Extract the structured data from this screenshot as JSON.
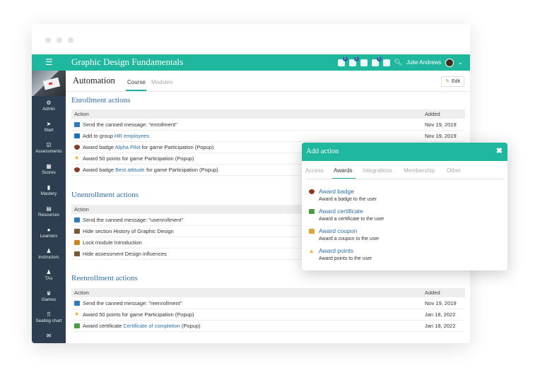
{
  "app": {
    "title": "Graphic Design Fundamentals",
    "menu_icon": "☰",
    "user_name": "Julie Andrews",
    "top_icons": [
      {
        "name": "notifications-icon",
        "badge": "1"
      },
      {
        "name": "flag-icon",
        "badge": "1"
      },
      {
        "name": "list-icon",
        "badge": ""
      },
      {
        "name": "cart-icon",
        "badge": "1"
      },
      {
        "name": "help-icon",
        "badge": ""
      }
    ]
  },
  "sidebar": {
    "items": [
      {
        "label": "Admin",
        "icon": "⚙"
      },
      {
        "label": "Start",
        "icon": "➤"
      },
      {
        "label": "Assessments",
        "icon": "☑"
      },
      {
        "label": "Scores",
        "icon": "▦"
      },
      {
        "label": "Mastery",
        "icon": "▮"
      },
      {
        "label": "Resources",
        "icon": "▤"
      },
      {
        "label": "Learners",
        "icon": "●"
      },
      {
        "label": "Instructors",
        "icon": "♟"
      },
      {
        "label": "TAs",
        "icon": "♟"
      },
      {
        "label": "Games",
        "icon": "♛"
      },
      {
        "label": "Seating chart",
        "icon": "⠿"
      },
      {
        "label": "",
        "icon": "✉"
      }
    ]
  },
  "page": {
    "title": "Automation",
    "tabs": [
      "Course",
      "Modules"
    ],
    "edit_label": "Edit"
  },
  "sections": {
    "enrollment": {
      "title": "Enrollment actions",
      "col_action": "Action",
      "col_added": "Added",
      "rows": [
        {
          "pre": "Send the canned message: \"enrollment\"",
          "link": "",
          "post": "",
          "date": "Nov 19, 2019",
          "icon": "message"
        },
        {
          "pre": "Add to group ",
          "link": "HR employees",
          "post": "",
          "date": "Nov 19, 2019",
          "icon": "group"
        },
        {
          "pre": "Award badge ",
          "link": "Alpha Pilot",
          "post": " for game Participation (Popup)",
          "date": "",
          "icon": "badge"
        },
        {
          "pre": "Award 50 points for game Participation (Popup)",
          "link": "",
          "post": "",
          "date": "",
          "icon": "star"
        },
        {
          "pre": "Award badge ",
          "link": "Best attitude",
          "post": " for game Participation (Popup)",
          "date": "",
          "icon": "badge"
        }
      ]
    },
    "unenrollment": {
      "title": "Unenrollment actions",
      "col_action": "Action",
      "rows": [
        {
          "pre": "Send the canned message: \"unenrollment\"",
          "link": "",
          "post": "",
          "icon": "message"
        },
        {
          "pre": "Hide section History of Graphic Design",
          "link": "",
          "post": "",
          "icon": "hide"
        },
        {
          "pre": "Lock module Introduction",
          "link": "",
          "post": "",
          "icon": "lock"
        },
        {
          "pre": "Hide assessment Design influences",
          "link": "",
          "post": "",
          "icon": "hide"
        }
      ]
    },
    "reenrollment": {
      "title": "Reenrollment actions",
      "col_action": "Action",
      "col_added": "Added",
      "rows": [
        {
          "pre": "Send the canned message: \"reenrollment\"",
          "link": "",
          "post": "",
          "date": "Nov 19, 2019",
          "icon": "message"
        },
        {
          "pre": "Award 50 points for game Participation (Popup)",
          "link": "",
          "post": "",
          "date": "Jan 18, 2022",
          "icon": "star"
        },
        {
          "pre": "Award certificate ",
          "link": "Certificate of completion",
          "post": " (Popup)",
          "date": "Jan 18, 2022",
          "icon": "certificate"
        }
      ]
    }
  },
  "modal": {
    "title": "Add action",
    "close": "✖",
    "tabs": [
      "Access",
      "Awards",
      "Integrations",
      "Membership",
      "Other"
    ],
    "active_tab": "Awards",
    "options": [
      {
        "title": "Award badge",
        "desc": "Award a badge to the user",
        "icon": "badge"
      },
      {
        "title": "Award certificate",
        "desc": "Award a certificate to the user",
        "icon": "certificate"
      },
      {
        "title": "Award coupon",
        "desc": "Award a coupon to the user",
        "icon": "coupon"
      },
      {
        "title": "Award points",
        "desc": "Award points to the user",
        "icon": "star"
      }
    ]
  },
  "colors": {
    "accent": "#1fb89f",
    "sidebar": "#2c3e50",
    "link": "#2d6ea9",
    "message_icon": "#2b7bbf",
    "group_icon": "#1a73b8",
    "badge_icon": "#8a3b1e",
    "star_icon": "#f0ac1f",
    "hide_icon": "#7a5a2f",
    "lock_icon": "#d4821a",
    "certificate_icon": "#4a9e3a",
    "coupon_icon": "#e0a53a"
  }
}
